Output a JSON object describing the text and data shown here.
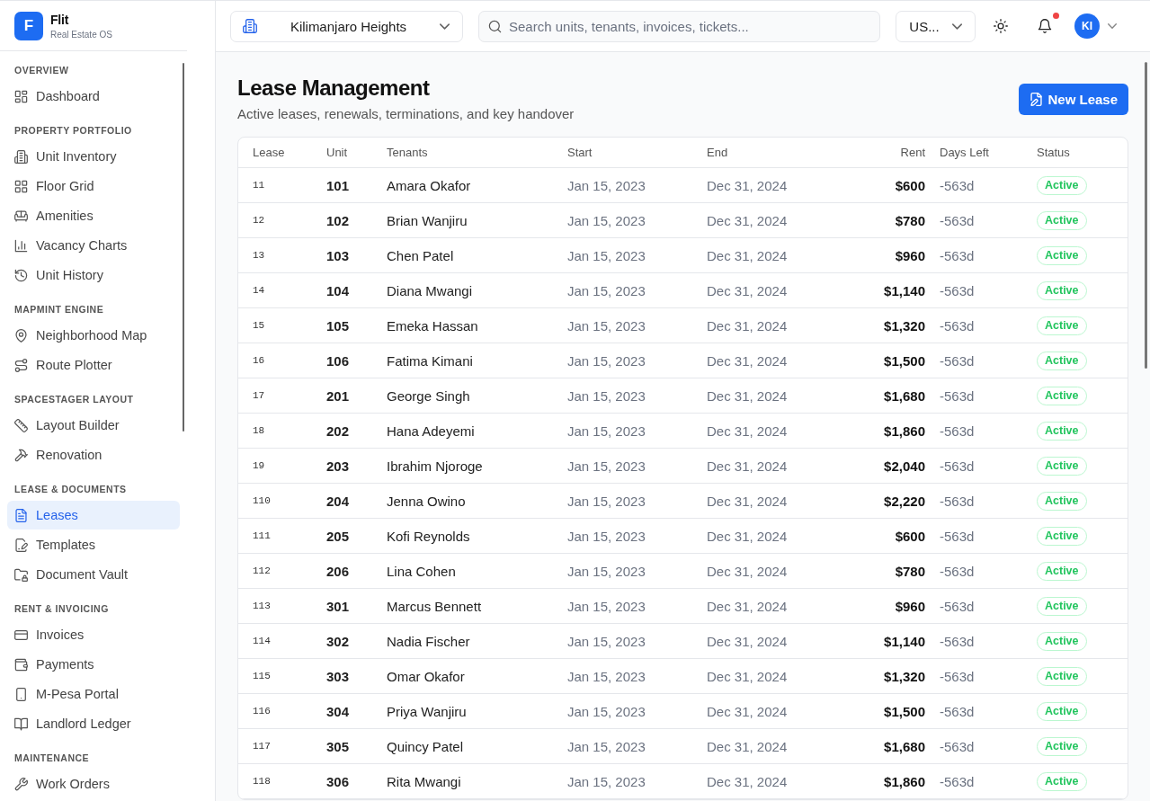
{
  "sidebar": {
    "brand": {
      "logo": "F",
      "name": "Flit",
      "tagline": "Real Estate OS"
    },
    "sections": [
      {
        "title": "OVERVIEW",
        "items": [
          {
            "label": "Dashboard",
            "selected": false
          }
        ]
      },
      {
        "title": "PROPERTY PORTFOLIO",
        "items": [
          {
            "label": "Unit Inventory",
            "selected": false
          },
          {
            "label": "Floor Grid",
            "selected": false
          },
          {
            "label": "Amenities",
            "selected": false
          },
          {
            "label": "Vacancy Charts",
            "selected": false
          },
          {
            "label": "Unit History",
            "selected": false
          }
        ]
      },
      {
        "title": "MAPMINT ENGINE",
        "items": [
          {
            "label": "Neighborhood Map",
            "selected": false
          },
          {
            "label": "Route Plotter",
            "selected": false
          }
        ]
      },
      {
        "title": "SPACESTAGER LAYOUT",
        "items": [
          {
            "label": "Layout Builder",
            "selected": false
          },
          {
            "label": "Renovation",
            "selected": false
          }
        ]
      },
      {
        "title": "LEASE & DOCUMENTS",
        "items": [
          {
            "label": "Leases",
            "selected": true
          },
          {
            "label": "Templates",
            "selected": false
          },
          {
            "label": "Document Vault",
            "selected": false
          }
        ]
      },
      {
        "title": "RENT & INVOICING",
        "items": [
          {
            "label": "Invoices",
            "selected": false
          },
          {
            "label": "Payments",
            "selected": false
          },
          {
            "label": "M-Pesa Portal",
            "selected": false
          },
          {
            "label": "Landlord Ledger",
            "selected": false
          }
        ]
      },
      {
        "title": "MAINTENANCE",
        "items": [
          {
            "label": "Work Orders",
            "selected": false
          }
        ]
      }
    ]
  },
  "topbar": {
    "property_selector": {
      "value": "Kilimanjaro Heights"
    },
    "search": {
      "placeholder": "Search units, tenants, invoices, tickets..."
    },
    "currency_selector": {
      "value": "US..."
    },
    "notifications": {
      "unread": true
    },
    "user": {
      "initials": "KI"
    }
  },
  "page": {
    "title": "Lease Management",
    "subtitle": "Active leases, renewals, terminations, and key handover",
    "primary_action": "New Lease"
  },
  "table": {
    "columns": [
      "Lease",
      "Unit",
      "Tenants",
      "Start",
      "End",
      "Rent",
      "Days Left",
      "Status"
    ],
    "rows": [
      {
        "lease": "11",
        "unit": "101",
        "tenants": "Amara Okafor",
        "start": "Jan 15, 2023",
        "end": "Dec 31, 2024",
        "rent": "$600",
        "days_left": "-563d",
        "status": "Active"
      },
      {
        "lease": "12",
        "unit": "102",
        "tenants": "Brian Wanjiru",
        "start": "Jan 15, 2023",
        "end": "Dec 31, 2024",
        "rent": "$780",
        "days_left": "-563d",
        "status": "Active"
      },
      {
        "lease": "13",
        "unit": "103",
        "tenants": "Chen Patel",
        "start": "Jan 15, 2023",
        "end": "Dec 31, 2024",
        "rent": "$960",
        "days_left": "-563d",
        "status": "Active"
      },
      {
        "lease": "14",
        "unit": "104",
        "tenants": "Diana Mwangi",
        "start": "Jan 15, 2023",
        "end": "Dec 31, 2024",
        "rent": "$1,140",
        "days_left": "-563d",
        "status": "Active"
      },
      {
        "lease": "15",
        "unit": "105",
        "tenants": "Emeka Hassan",
        "start": "Jan 15, 2023",
        "end": "Dec 31, 2024",
        "rent": "$1,320",
        "days_left": "-563d",
        "status": "Active"
      },
      {
        "lease": "16",
        "unit": "106",
        "tenants": "Fatima Kimani",
        "start": "Jan 15, 2023",
        "end": "Dec 31, 2024",
        "rent": "$1,500",
        "days_left": "-563d",
        "status": "Active"
      },
      {
        "lease": "17",
        "unit": "201",
        "tenants": "George Singh",
        "start": "Jan 15, 2023",
        "end": "Dec 31, 2024",
        "rent": "$1,680",
        "days_left": "-563d",
        "status": "Active"
      },
      {
        "lease": "18",
        "unit": "202",
        "tenants": "Hana Adeyemi",
        "start": "Jan 15, 2023",
        "end": "Dec 31, 2024",
        "rent": "$1,860",
        "days_left": "-563d",
        "status": "Active"
      },
      {
        "lease": "19",
        "unit": "203",
        "tenants": "Ibrahim Njoroge",
        "start": "Jan 15, 2023",
        "end": "Dec 31, 2024",
        "rent": "$2,040",
        "days_left": "-563d",
        "status": "Active"
      },
      {
        "lease": "110",
        "unit": "204",
        "tenants": "Jenna Owino",
        "start": "Jan 15, 2023",
        "end": "Dec 31, 2024",
        "rent": "$2,220",
        "days_left": "-563d",
        "status": "Active"
      },
      {
        "lease": "111",
        "unit": "205",
        "tenants": "Kofi Reynolds",
        "start": "Jan 15, 2023",
        "end": "Dec 31, 2024",
        "rent": "$600",
        "days_left": "-563d",
        "status": "Active"
      },
      {
        "lease": "112",
        "unit": "206",
        "tenants": "Lina Cohen",
        "start": "Jan 15, 2023",
        "end": "Dec 31, 2024",
        "rent": "$780",
        "days_left": "-563d",
        "status": "Active"
      },
      {
        "lease": "113",
        "unit": "301",
        "tenants": "Marcus Bennett",
        "start": "Jan 15, 2023",
        "end": "Dec 31, 2024",
        "rent": "$960",
        "days_left": "-563d",
        "status": "Active"
      },
      {
        "lease": "114",
        "unit": "302",
        "tenants": "Nadia Fischer",
        "start": "Jan 15, 2023",
        "end": "Dec 31, 2024",
        "rent": "$1,140",
        "days_left": "-563d",
        "status": "Active"
      },
      {
        "lease": "115",
        "unit": "303",
        "tenants": "Omar Okafor",
        "start": "Jan 15, 2023",
        "end": "Dec 31, 2024",
        "rent": "$1,320",
        "days_left": "-563d",
        "status": "Active"
      },
      {
        "lease": "116",
        "unit": "304",
        "tenants": "Priya Wanjiru",
        "start": "Jan 15, 2023",
        "end": "Dec 31, 2024",
        "rent": "$1,500",
        "days_left": "-563d",
        "status": "Active"
      },
      {
        "lease": "117",
        "unit": "305",
        "tenants": "Quincy Patel",
        "start": "Jan 15, 2023",
        "end": "Dec 31, 2024",
        "rent": "$1,680",
        "days_left": "-563d",
        "status": "Active"
      },
      {
        "lease": "118",
        "unit": "306",
        "tenants": "Rita Mwangi",
        "start": "Jan 15, 2023",
        "end": "Dec 31, 2024",
        "rent": "$1,860",
        "days_left": "-563d",
        "status": "Active"
      }
    ]
  }
}
